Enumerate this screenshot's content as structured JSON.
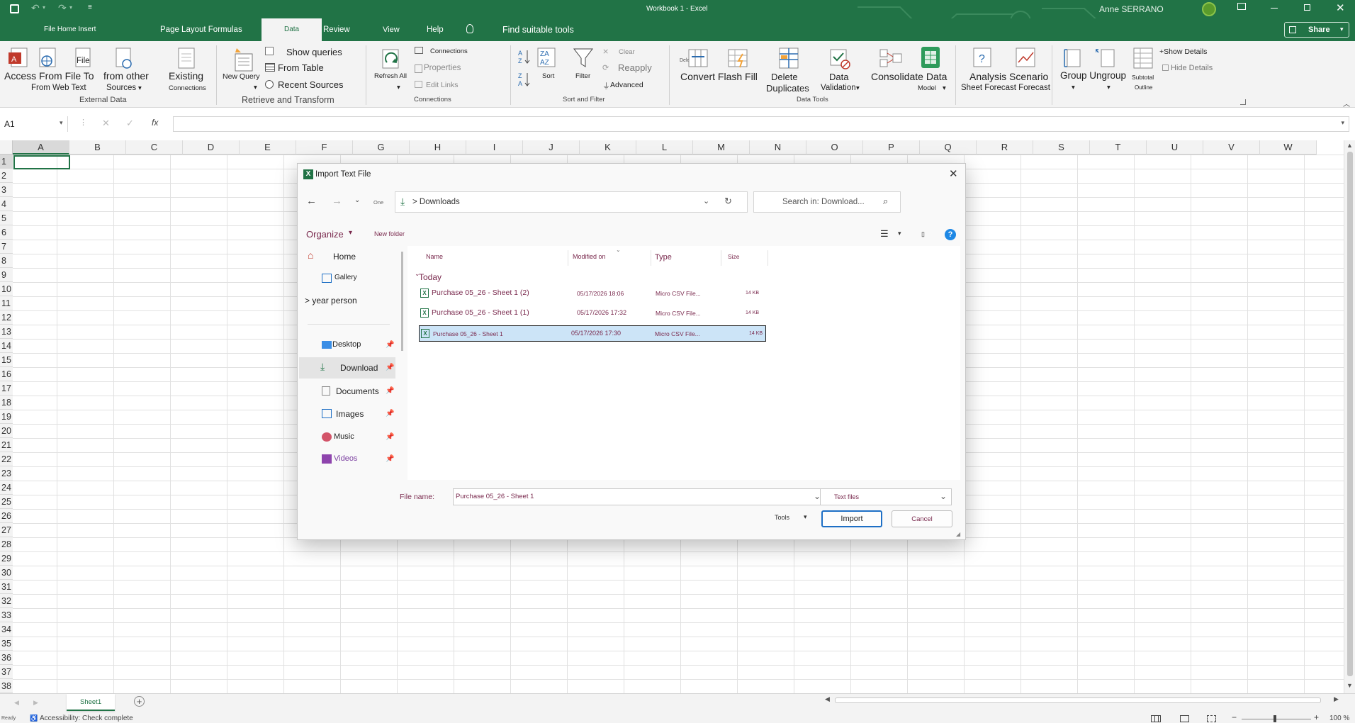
{
  "app": {
    "window_title": "Workbook 1 - Excel",
    "user_name": "Anne SERRANO",
    "share_label": "Share"
  },
  "ribbon_tabs": [
    {
      "label": "File Home Insert"
    },
    {
      "label": "Page Layout Formulas"
    },
    {
      "label": "Data"
    },
    {
      "label": "Review"
    },
    {
      "label": "View"
    },
    {
      "label": "Help"
    },
    {
      "label": "Find suitable tools"
    }
  ],
  "ribbon": {
    "external_data": {
      "line1": "Access From File To",
      "line2": "From Web Text",
      "file_label": "File",
      "other_sources_1": "from other",
      "other_sources_2": "Sources",
      "existing_1": "Existing",
      "existing_2": "Connections",
      "group_label": "External Data"
    },
    "retrieve": {
      "new_query": "New Query",
      "show_queries": "Show queries",
      "from_table": "From Table",
      "recent_sources": "Recent Sources",
      "group_label": "Retrieve and Transform"
    },
    "connections": {
      "refresh_all": "Refresh All",
      "connections": "Connections",
      "properties": "Properties",
      "edit_links": "Edit Links",
      "group_label": "Connections"
    },
    "sort_filter": {
      "sort": "Sort",
      "filter": "Filter",
      "clear": "Clear",
      "reapply": "Reapply",
      "advanced": "Advanced",
      "group_label": "Sort and Filter"
    },
    "data_tools": {
      "convert_flash": "Convert Flash Fill",
      "delete_small": "Delete",
      "delete_1": "Delete",
      "delete_2": "Duplicates",
      "validation_1": "Data",
      "validation_2": "Validation",
      "consolidate": "Consolidate Data",
      "model": "Model",
      "group_label": "Data Tools"
    },
    "forecast": {
      "analysis": "Analysis Scenario",
      "sheet_forecast": "Sheet Forecast Forecast"
    },
    "outline": {
      "group_ungroup": "Group Ungroup",
      "subtotal": "Subtotal",
      "show_details": "+Show Details",
      "hide_details": "Hide Details",
      "group_label": "Outline"
    }
  },
  "formula_bar": {
    "name_box": "A1",
    "fx": "fx",
    "value": ""
  },
  "columns": [
    "A",
    "B",
    "C",
    "D",
    "E",
    "F",
    "G",
    "H",
    "I",
    "J",
    "K",
    "L",
    "M",
    "N",
    "O",
    "P",
    "Q",
    "R",
    "S",
    "T",
    "U",
    "V",
    "W"
  ],
  "rows": [
    "1",
    "2",
    "3",
    "4",
    "5",
    "6",
    "7",
    "8",
    "9",
    "10",
    "11",
    "12",
    "13",
    "14",
    "15",
    "16",
    "17",
    "18",
    "19",
    "20",
    "21",
    "22",
    "23",
    "24",
    "25",
    "26",
    "27",
    "28",
    "29",
    "30",
    "31",
    "32",
    "33",
    "34",
    "35",
    "36",
    "37",
    "38"
  ],
  "dialog": {
    "title": "Import Text File",
    "path_prefix": "One",
    "path": "> Downloads",
    "search_placeholder": "Search in: Download...",
    "organize": "Organize",
    "new_folder": "New folder",
    "nav": {
      "home": "Home",
      "gallery": "Gallery",
      "person": "> year person",
      "desktop": "Desktop",
      "download": "Download",
      "documents": "Documents",
      "images": "Images",
      "music": "Music",
      "videos": "Videos"
    },
    "columns": {
      "name": "Name",
      "modified": "Modified on",
      "type": "Type",
      "size": "Size"
    },
    "group": "Today",
    "files": [
      {
        "name": "Purchase 05_26 - Sheet 1 (2)",
        "modified": "05/17/2026 18:06",
        "type": "Micro CSV File...",
        "size": "14 KB"
      },
      {
        "name": "Purchase 05_26 - Sheet 1 (1)",
        "modified": "05/17/2026 17:32",
        "type": "Micro CSV File...",
        "size": "14 KB"
      },
      {
        "name": "Purchase 05_26 - Sheet 1",
        "modified": "05/17/2026 17:30",
        "type": "Micro CSV File...",
        "size": "14 KB"
      }
    ],
    "file_name_label": "File name:",
    "file_name_value": "Purchase 05_26 - Sheet 1",
    "file_type": "Text files",
    "tools": "Tools",
    "import": "Import",
    "cancel": "Cancel"
  },
  "sheet_tabs": {
    "active": "Sheet1"
  },
  "status": {
    "ready": "Ready",
    "accessibility": "Accessibility: Check complete",
    "zoom": "100 %"
  },
  "colors": {
    "excel_green": "#217346",
    "selection_blue": "#cce4f7",
    "file_text": "#7a2a4e"
  }
}
